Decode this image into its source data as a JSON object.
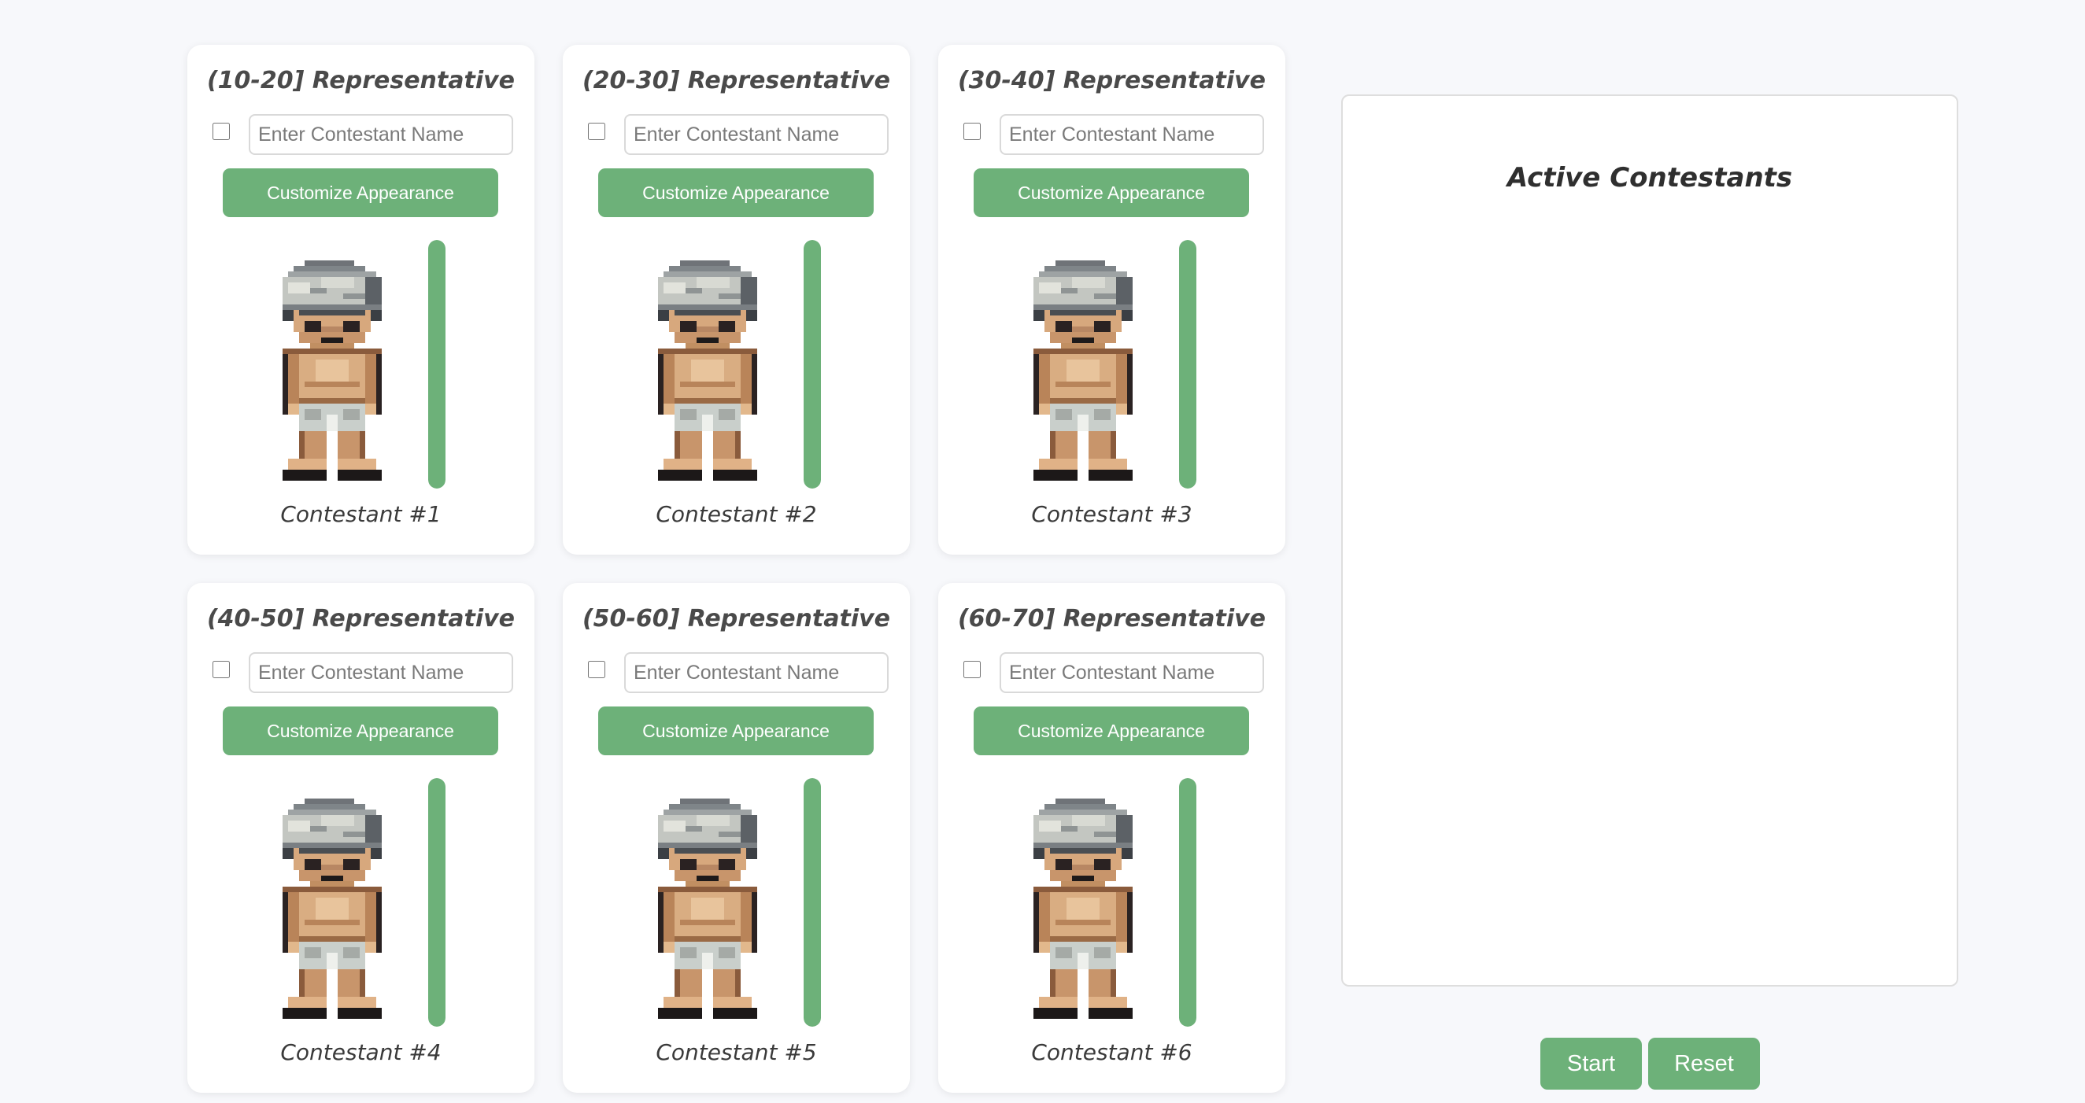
{
  "contestants": [
    {
      "title": "(10-20] Representative",
      "placeholder": "Enter Contestant Name",
      "button": "Customize Appearance",
      "label": "Contestant #1",
      "level": 1.0
    },
    {
      "title": "(20-30] Representative",
      "placeholder": "Enter Contestant Name",
      "button": "Customize Appearance",
      "label": "Contestant #2",
      "level": 1.0
    },
    {
      "title": "(30-40] Representative",
      "placeholder": "Enter Contestant Name",
      "button": "Customize Appearance",
      "label": "Contestant #3",
      "level": 1.0
    },
    {
      "title": "(40-50] Representative",
      "placeholder": "Enter Contestant Name",
      "button": "Customize Appearance",
      "label": "Contestant #4",
      "level": 1.0
    },
    {
      "title": "(50-60] Representative",
      "placeholder": "Enter Contestant Name",
      "button": "Customize Appearance",
      "label": "Contestant #5",
      "level": 1.0
    },
    {
      "title": "(60-70] Representative",
      "placeholder": "Enter Contestant Name",
      "button": "Customize Appearance",
      "label": "Contestant #6",
      "level": 1.0
    }
  ],
  "active_panel": {
    "title": "Active Contestants"
  },
  "controls": {
    "start": "Start",
    "reset": "Reset"
  },
  "colors": {
    "accent": "#6db179",
    "background": "#f7f8fb",
    "card": "#ffffff",
    "title_text": "#4a4a4a"
  },
  "icons": {
    "sprite": "pixel-character-sprite"
  }
}
